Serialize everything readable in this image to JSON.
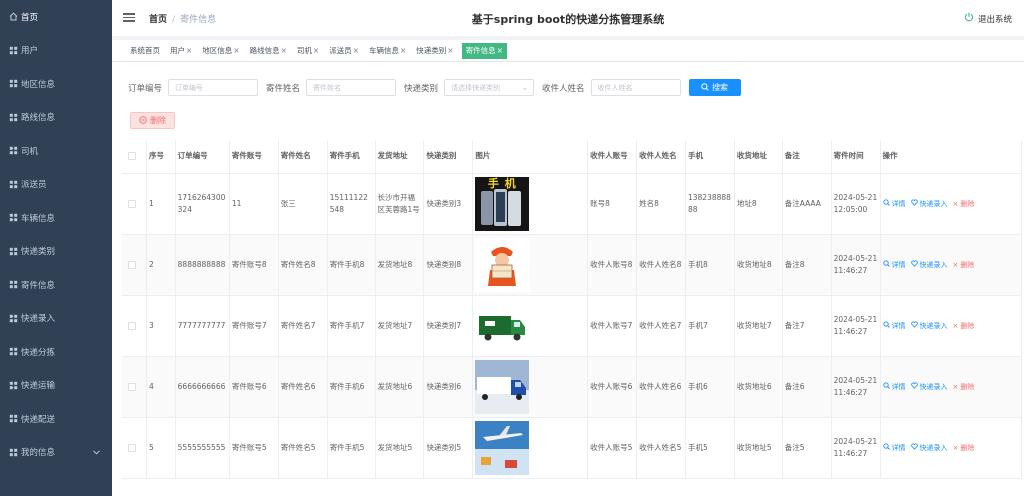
{
  "sidebar": {
    "items": [
      {
        "label": "首页",
        "icon": "home-icon"
      },
      {
        "label": "用户",
        "icon": "grid-icon"
      },
      {
        "label": "地区信息",
        "icon": "grid-icon"
      },
      {
        "label": "路线信息",
        "icon": "grid-icon"
      },
      {
        "label": "司机",
        "icon": "grid-icon"
      },
      {
        "label": "派送员",
        "icon": "grid-icon"
      },
      {
        "label": "车辆信息",
        "icon": "grid-icon"
      },
      {
        "label": "快递类别",
        "icon": "grid-icon"
      },
      {
        "label": "寄件信息",
        "icon": "grid-icon"
      },
      {
        "label": "快递录入",
        "icon": "grid-icon"
      },
      {
        "label": "快递分拣",
        "icon": "grid-icon"
      },
      {
        "label": "快递运输",
        "icon": "grid-icon"
      },
      {
        "label": "快递配送",
        "icon": "grid-icon"
      },
      {
        "label": "我的信息",
        "icon": "grid-icon"
      }
    ]
  },
  "header": {
    "breadcrumb_home": "首页",
    "breadcrumb_current": "寄件信息",
    "title": "基于spring boot的快递分拣管理系统",
    "logout": "退出系统"
  },
  "tags": [
    {
      "label": "系统首页",
      "closable": false,
      "active": false
    },
    {
      "label": "用户",
      "closable": true,
      "active": false
    },
    {
      "label": "地区信息",
      "closable": true,
      "active": false
    },
    {
      "label": "路线信息",
      "closable": true,
      "active": false
    },
    {
      "label": "司机",
      "closable": true,
      "active": false
    },
    {
      "label": "派送员",
      "closable": true,
      "active": false
    },
    {
      "label": "车辆信息",
      "closable": true,
      "active": false
    },
    {
      "label": "快递类别",
      "closable": true,
      "active": false
    },
    {
      "label": "寄件信息",
      "closable": true,
      "active": true
    }
  ],
  "search": {
    "order_label": "订单编号",
    "order_placeholder": "订单编号",
    "sender_label": "寄件姓名",
    "sender_placeholder": "寄件姓名",
    "type_label": "快递类别",
    "type_placeholder": "请选择快递类别",
    "receiver_label": "收件人姓名",
    "receiver_placeholder": "收件人姓名",
    "search_button": "搜索"
  },
  "delete_button": "删除",
  "table": {
    "columns": [
      "序号",
      "订单编号",
      "寄件账号",
      "寄件姓名",
      "寄件手机",
      "发货地址",
      "快递类别",
      "图片",
      "收件人账号",
      "收件人姓名",
      "手机",
      "收货地址",
      "备注",
      "寄件时间",
      "操作"
    ],
    "op_detail": "详情",
    "op_entry": "快递录入",
    "op_delete": "删除",
    "rows": [
      {
        "no": "1",
        "order": "1716264300324",
        "account": "11",
        "name": "张三",
        "phone": "15111122548",
        "address": "长沙市开福区芙蓉路1号",
        "type": "快递类别3",
        "image": "phone",
        "image_text": "手 机",
        "r_account": "账号8",
        "r_name": "姓名8",
        "mobile": "13823888888",
        "r_address": "地址8",
        "remark": "备注AAAA",
        "time": "2024-05-21 12:05:00"
      },
      {
        "no": "2",
        "order": "8888888888",
        "account": "寄件账号8",
        "name": "寄件姓名8",
        "phone": "寄件手机8",
        "address": "发货地址8",
        "type": "快递类别8",
        "image": "courier",
        "image_text": "",
        "r_account": "收件人账号8",
        "r_name": "收件人姓名8",
        "mobile": "手机8",
        "r_address": "收货地址8",
        "remark": "备注8",
        "time": "2024-05-21 11:46:27"
      },
      {
        "no": "3",
        "order": "7777777777",
        "account": "寄件账号7",
        "name": "寄件姓名7",
        "phone": "寄件手机7",
        "address": "发货地址7",
        "type": "快递类别7",
        "image": "van",
        "image_text": "",
        "r_account": "收件人账号7",
        "r_name": "收件人姓名7",
        "mobile": "手机7",
        "r_address": "收货地址7",
        "remark": "备注7",
        "time": "2024-05-21 11:46:27"
      },
      {
        "no": "4",
        "order": "6666666666",
        "account": "寄件账号6",
        "name": "寄件姓名6",
        "phone": "寄件手机6",
        "address": "发货地址6",
        "type": "快递类别6",
        "image": "truck",
        "image_text": "",
        "r_account": "收件人账号6",
        "r_name": "收件人姓名6",
        "mobile": "手机6",
        "r_address": "收货地址6",
        "remark": "备注6",
        "time": "2024-05-21 11:46:27"
      },
      {
        "no": "5",
        "order": "5555555555",
        "account": "寄件账号5",
        "name": "寄件姓名5",
        "phone": "寄件手机5",
        "address": "发货地址5",
        "type": "快递类别5",
        "image": "plane",
        "image_text": "",
        "r_account": "收件人账号5",
        "r_name": "收件人姓名5",
        "mobile": "手机5",
        "r_address": "收货地址5",
        "remark": "备注5",
        "time": "2024-05-21 11:46:27"
      }
    ]
  }
}
